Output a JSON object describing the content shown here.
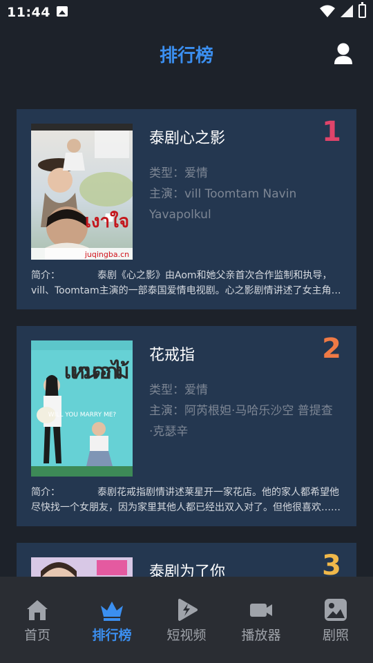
{
  "status_bar": {
    "time": "11:44"
  },
  "header": {
    "title": "排行榜"
  },
  "colors": {
    "accent": "#3b8ff0",
    "background": "#1d222a",
    "card": "#243750",
    "rank_1": "#e0446a",
    "rank_2": "#ef7a45",
    "rank_3": "#f0b84a"
  },
  "items": [
    {
      "rank": "1",
      "title": "泰剧心之影",
      "type": "类型：爱情",
      "cast": "主演：vill Toomtam Navin Yavapolkul",
      "intro_label": "简介：",
      "intro": "泰剧《心之影》由Aom和她父亲首次合作监制和执导，vill、Toomtam主演的一部泰国爱情电视剧。心之影剧情讲述了女主角的故事……",
      "poster_caption": "juqingba.cn",
      "poster_title": "เงาใจ"
    },
    {
      "rank": "2",
      "title": "花戒指",
      "type": "类型：爱情",
      "cast": "主演：阿芮根妲·马哈乐沙空 普提查·克瑟辛",
      "intro_label": "简介：",
      "intro": "泰剧花戒指剧情讲述莱星开一家花店。他的家人都希望他尽快找一个女朋友，因为家里其他人都已经出双入对了。但他很喜欢……",
      "poster_title": "แหวนดอกไม้",
      "poster_subtitle": "WILL YOU MARRY ME?"
    },
    {
      "rank": "3",
      "title": "泰剧为了你"
    }
  ],
  "tabs": [
    {
      "label": "首页",
      "icon": "home-icon"
    },
    {
      "label": "排行榜",
      "icon": "crown-icon",
      "active": true
    },
    {
      "label": "短视频",
      "icon": "flash-video-icon"
    },
    {
      "label": "播放器",
      "icon": "video-camera-icon"
    },
    {
      "label": "剧照",
      "icon": "image-icon"
    }
  ]
}
